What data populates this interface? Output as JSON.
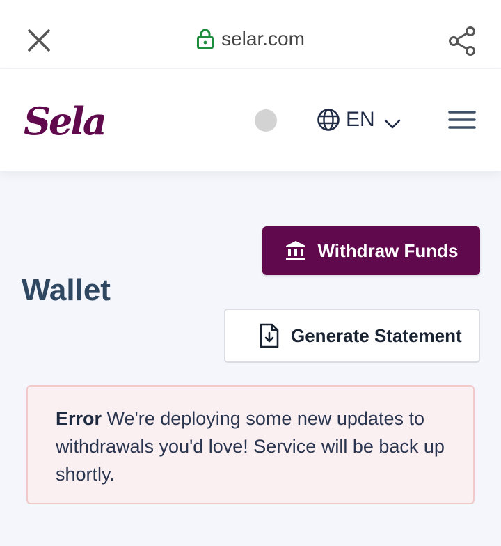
{
  "browser": {
    "url": "selar.com",
    "icons": [
      "close-icon",
      "lock-icon",
      "share-icon"
    ],
    "lock_color": "#1e8e3e"
  },
  "header": {
    "logo_text": "Selar",
    "language": "EN",
    "icons": [
      "globe-icon",
      "chevron-down-icon",
      "hamburger-menu-icon"
    ],
    "brand_color": "#600a4d"
  },
  "main": {
    "title": "Wallet",
    "withdraw_label": "Withdraw Funds",
    "statement_label": "Generate Statement",
    "alert": {
      "label": "Error",
      "message": "We're deploying some new updates to withdrawals you'd love! Service will be back up shortly."
    }
  }
}
